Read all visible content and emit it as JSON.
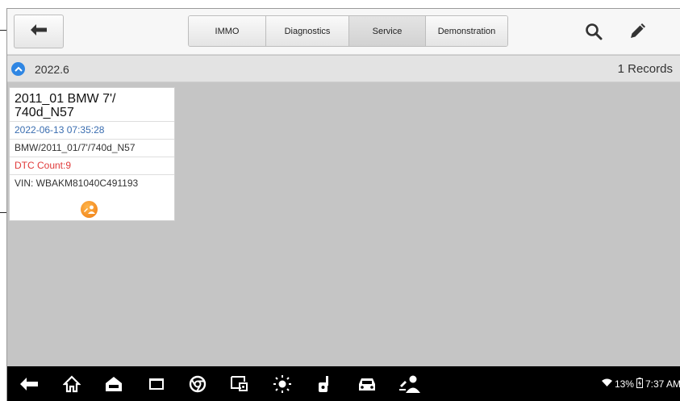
{
  "toolbar": {
    "tabs": [
      {
        "label": "IMMO",
        "active": false
      },
      {
        "label": "Diagnostics",
        "active": false
      },
      {
        "label": "Service",
        "active": true
      },
      {
        "label": "Demonstration",
        "active": false
      }
    ],
    "icons": [
      "back-arrow-icon",
      "search-icon",
      "pencil-icon"
    ]
  },
  "group": {
    "title": "2022.6",
    "count": "1 Records"
  },
  "record": {
    "title": "2011_01 BMW 7'/\n740d_N57",
    "date": "2022-06-13 07:35:28",
    "path": "BMW/2011_01/7'/740d_N57",
    "dtc": "DTC Count:9",
    "vin": "VIN: WBAKM81040C491193"
  },
  "status_bar": {
    "battery": "13%",
    "time": "7:37 AM"
  },
  "colors": {
    "accent_blue": "#2f86e3",
    "dtc_red": "#e03a3a",
    "date_blue": "#3a6db0",
    "badge_orange": "#ee7b12"
  }
}
